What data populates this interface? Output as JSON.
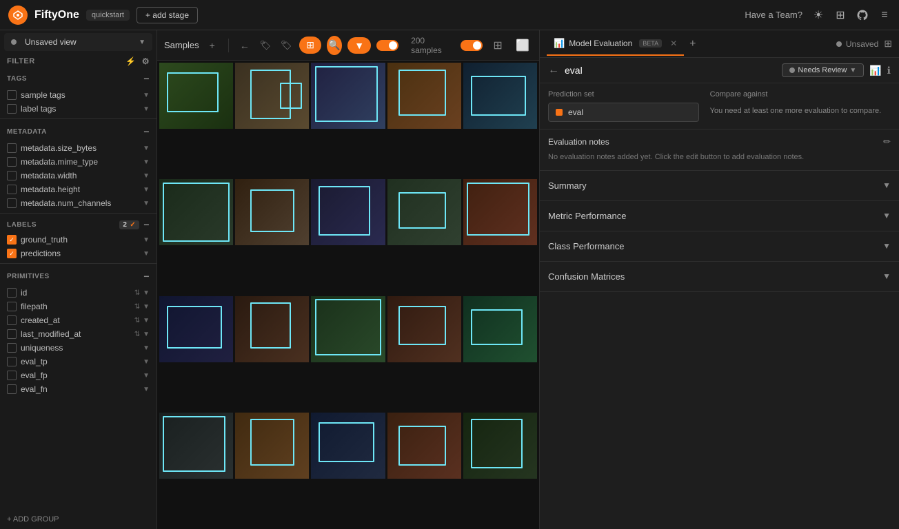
{
  "topbar": {
    "logo": "FO",
    "title": "FiftyOne",
    "quickstart": "quickstart",
    "add_stage": "+ add stage",
    "have_team": "Have a Team?",
    "close_icon": "✕",
    "help_icon": "?",
    "sun_icon": "☀",
    "grid_icon": "⊞",
    "github_icon": "⬡",
    "bars_icon": "≡"
  },
  "sidebar": {
    "unsaved_view": "Unsaved view",
    "filter_label": "FILTER",
    "tags_section": "TAGS",
    "tags_items": [
      {
        "label": "sample tags"
      },
      {
        "label": "label tags"
      }
    ],
    "metadata_section": "METADATA",
    "metadata_items": [
      {
        "label": "metadata.size_bytes"
      },
      {
        "label": "metadata.mime_type"
      },
      {
        "label": "metadata.width"
      },
      {
        "label": "metadata.height"
      },
      {
        "label": "metadata.num_channels"
      }
    ],
    "labels_section": "LABELS",
    "labels_count": "2",
    "labels_items": [
      {
        "label": "ground_truth",
        "checked": true
      },
      {
        "label": "predictions",
        "checked": true
      }
    ],
    "primitives_section": "PRIMITIVES",
    "primitives_items": [
      {
        "label": "id"
      },
      {
        "label": "filepath"
      },
      {
        "label": "created_at"
      },
      {
        "label": "last_modified_at"
      },
      {
        "label": "uniqueness"
      },
      {
        "label": "eval_tp"
      },
      {
        "label": "eval_fp"
      },
      {
        "label": "eval_fn"
      }
    ],
    "add_group": "+ ADD GROUP"
  },
  "samples_panel": {
    "tab_label": "Samples",
    "samples_count": "200 samples",
    "add_icon": "+"
  },
  "right_panel": {
    "tab_label": "Model Evaluation",
    "tab_beta": "BETA",
    "close_icon": "✕",
    "add_icon": "+",
    "unsaved_label": "Unsaved",
    "back_icon": "←",
    "eval_name": "eval",
    "needs_review_label": "Needs Review",
    "bar_chart_icon": "📊",
    "info_icon": "ℹ",
    "prediction_set_label": "Prediction set",
    "prediction_set_value": "eval",
    "compare_against_label": "Compare against",
    "compare_against_text": "You need at least one more evaluation to compare.",
    "eval_notes_title": "Evaluation notes",
    "eval_notes_text": "No evaluation notes added yet. Click the edit button to add evaluation notes.",
    "summary_label": "Summary",
    "metric_performance_label": "Metric Performance",
    "class_performance_label": "Class Performance",
    "confusion_matrices_label": "Confusion Matrices"
  },
  "images": [
    {
      "id": 1,
      "cls": "img-1"
    },
    {
      "id": 2,
      "cls": "img-2"
    },
    {
      "id": 3,
      "cls": "img-3"
    },
    {
      "id": 4,
      "cls": "img-4"
    },
    {
      "id": 5,
      "cls": "img-5"
    },
    {
      "id": 6,
      "cls": "img-6"
    },
    {
      "id": 7,
      "cls": "img-7"
    },
    {
      "id": 8,
      "cls": "img-8"
    },
    {
      "id": 9,
      "cls": "img-9"
    },
    {
      "id": 10,
      "cls": "img-10"
    },
    {
      "id": 11,
      "cls": "img-11"
    },
    {
      "id": 12,
      "cls": "img-12"
    },
    {
      "id": 13,
      "cls": "img-13"
    },
    {
      "id": 14,
      "cls": "img-14"
    },
    {
      "id": 15,
      "cls": "img-15"
    },
    {
      "id": 16,
      "cls": "img-16"
    },
    {
      "id": 17,
      "cls": "img-17"
    },
    {
      "id": 18,
      "cls": "img-18"
    },
    {
      "id": 19,
      "cls": "img-19"
    },
    {
      "id": 20,
      "cls": "img-20"
    }
  ]
}
